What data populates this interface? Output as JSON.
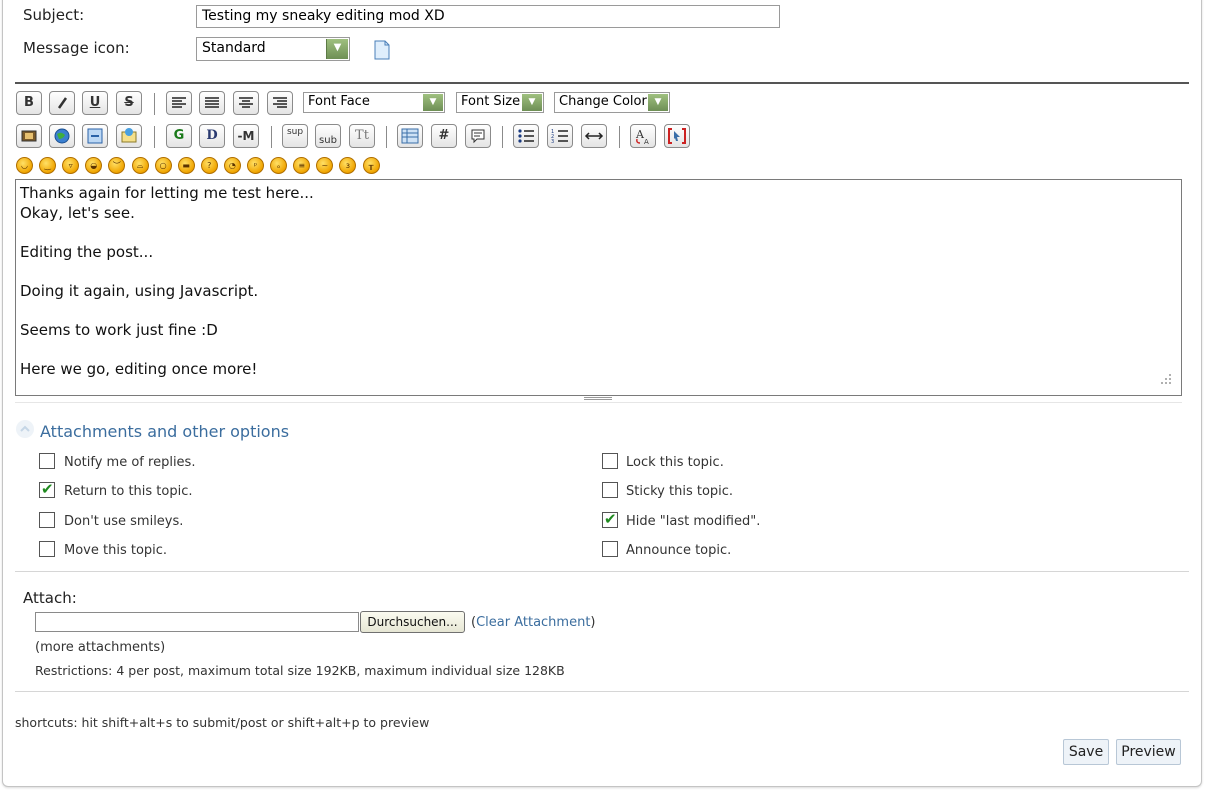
{
  "header": {
    "subject_label": "Subject:",
    "subject_value": "Testing my sneaky editing mod XD",
    "icon_label": "Message icon:",
    "icon_selected": "Standard"
  },
  "toolbar": {
    "font_face": "Font Face",
    "font_size": "Font Size",
    "change_color": "Change Color",
    "buttons_row1": [
      "bold",
      "italic",
      "underline",
      "strikethrough",
      "align-left",
      "align-justify",
      "align-center",
      "align-right"
    ],
    "buttons_row2": [
      "flash",
      "image",
      "link",
      "email",
      "ftp",
      "glow",
      "shadow",
      "marquee",
      "superscript",
      "subscript",
      "teletype",
      "table",
      "code",
      "quote",
      "unordered-list",
      "ordered-list",
      "horizontal-rule",
      "remove-formatting",
      "toggle-view"
    ],
    "bold": "B",
    "italic": "I",
    "underline": "U",
    "strike": "S",
    "glow": "G",
    "shadow": "D",
    "marquee": "-M",
    "sup": "sup",
    "sub": "sub",
    "tt": "Tt",
    "code": "#",
    "smileys": [
      "smiley",
      "wink",
      "cheesy",
      "grin",
      "angry",
      "sad",
      "shocked",
      "cool",
      "huh",
      "rolleyes",
      "tongue",
      "embarrassed",
      "lipsrsealed",
      "undecided",
      "kiss",
      "cry"
    ]
  },
  "editor": {
    "content": "Thanks again for letting me test here...\nOkay, let's see.\n\nEditing the post...\n\nDoing it again, using Javascript.\n\nSeems to work just fine :D\n\nHere we go, editing once more!"
  },
  "options": {
    "title": "Attachments and other options",
    "left": [
      {
        "label": "Notify me of replies.",
        "checked": false
      },
      {
        "label": "Return to this topic.",
        "checked": true
      },
      {
        "label": "Don't use smileys.",
        "checked": false
      },
      {
        "label": "Move this topic.",
        "checked": false
      }
    ],
    "right": [
      {
        "label": "Lock this topic.",
        "checked": false
      },
      {
        "label": "Sticky this topic.",
        "checked": false
      },
      {
        "label": "Hide \"last modified\".",
        "checked": true
      },
      {
        "label": "Announce topic.",
        "checked": false
      }
    ]
  },
  "attach": {
    "label": "Attach:",
    "browse": "Durchsuchen...",
    "clear_open": "(",
    "clear": "Clear Attachment",
    "clear_close": ")",
    "more": "(more attachments)",
    "restrictions": "Restrictions: 4 per post, maximum total size 192KB, maximum individual size 128KB"
  },
  "footer": {
    "shortcuts": "shortcuts: hit shift+alt+s to submit/post or shift+alt+p to preview",
    "save": "Save",
    "preview": "Preview"
  },
  "colors": {
    "link": "#3b6d9e",
    "select_arrow": "#7fa262",
    "checkmark": "#1f8a1f",
    "button_bg": "#eef3f8"
  }
}
